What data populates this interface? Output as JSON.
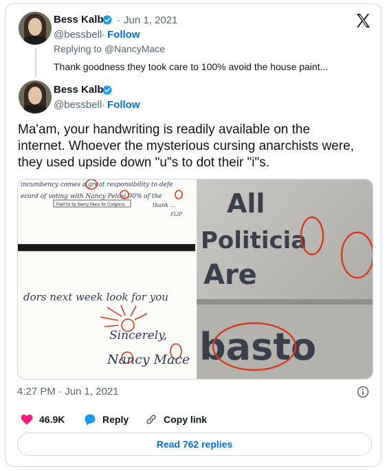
{
  "colors": {
    "accent": "#006fd6",
    "heart": "#f91880",
    "reply_bubble": "#1d9bf0",
    "muted": "#536471",
    "border": "#cfd9de",
    "annotation_red": "#d63a1c"
  },
  "parent_tweet": {
    "author_name": "Bess Kalb",
    "separator": "·",
    "date": "Jun 1, 2021",
    "handle": "@bessbell",
    "follow_label": "Follow",
    "replying_prefix": "Replying to",
    "replying_to": "@NancyMace",
    "text": "Thank goodness they took care to 100% avoid the house paint..."
  },
  "main_tweet": {
    "author_name": "Bess Kalb",
    "handle": "@bessbell",
    "follow_label": "Follow",
    "text_lines": [
      "Ma'am, your handwriting is readily available on the",
      "internet. Whoever the mysterious cursing anarchists were,",
      "they  used upside down \"u\"s to dot their \"i\"s."
    ],
    "timestamp": "4:27 PM · Jun 1, 2021"
  },
  "media": {
    "letter": {
      "line1": "incumbency comes a great responsibility to defe",
      "line2": "ecord of voting with Nancy Pelosi 90% of the",
      "paid_for": "Paid for by Nancy Mace for Congress",
      "thanks": "thank ...",
      "flip": "FLIP",
      "line3": "dors next week look for you",
      "closing": "Sincerely,",
      "signature": "Nancy Mace"
    },
    "graffiti": {
      "line1": "All",
      "line2": "Politicia",
      "line3": "Are",
      "line4": "basto"
    }
  },
  "actions": {
    "like_count": "46.9K",
    "reply_label": "Reply",
    "copy_label": "Copy link",
    "read_replies": "Read 762 replies"
  },
  "icons": {
    "verified": "verified-badge-icon",
    "x_logo": "x-logo-icon",
    "info": "info-icon",
    "heart": "heart-icon",
    "reply": "reply-bubble-icon",
    "link": "link-icon"
  }
}
